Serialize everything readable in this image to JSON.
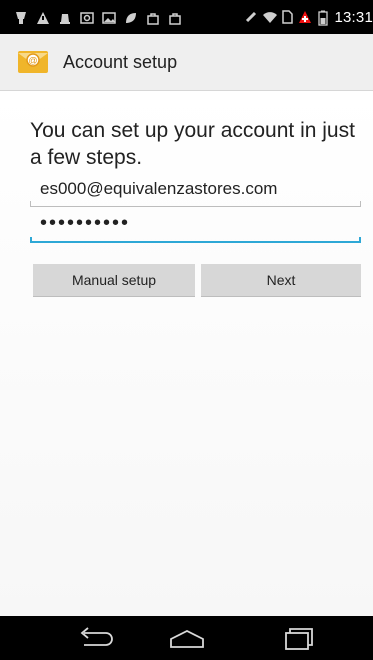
{
  "status_bar": {
    "time": "13:31",
    "icons": [
      "usb-icon",
      "warning-icon",
      "bell-icon",
      "image-icon",
      "gallery-icon",
      "leaf-icon",
      "bag-icon",
      "bag-icon",
      "rotate-icon",
      "wifi-icon",
      "sim-icon",
      "medical-alert-icon",
      "battery-icon"
    ]
  },
  "action_bar": {
    "title": "Account setup",
    "icon": "email-app-icon"
  },
  "form": {
    "intro": "You can set up your account in just a few steps.",
    "email_value": "es000@equivalenzastores.com",
    "password_value": "••••••••••"
  },
  "buttons": {
    "manual_setup": "Manual setup",
    "next": "Next"
  },
  "nav_bar": {
    "back": "back-icon",
    "home": "home-icon",
    "recents": "recents-icon"
  },
  "colors": {
    "accent": "#2ea8d6",
    "action_bar_bg": "#efefef",
    "button_bg": "#d7d7d7"
  }
}
